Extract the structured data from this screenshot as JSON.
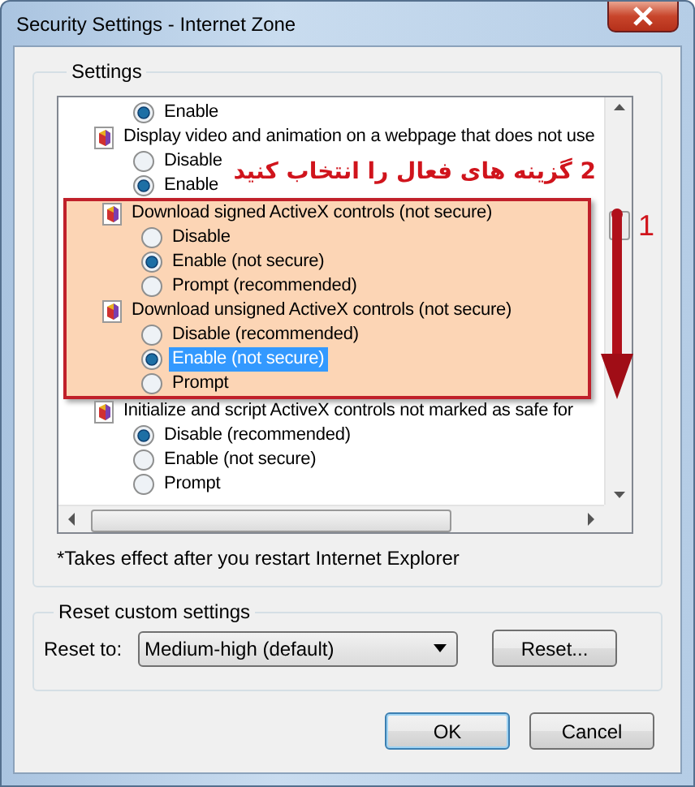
{
  "window": {
    "title": "Security Settings - Internet Zone"
  },
  "settings": {
    "label": "Settings",
    "items": [
      {
        "kind": "radio",
        "label": "Enable",
        "selected": true,
        "highlighted": false
      },
      {
        "kind": "heading",
        "label": "Display video and animation on a webpage that does not use"
      },
      {
        "kind": "radio",
        "label": "Disable",
        "selected": false,
        "highlighted": false
      },
      {
        "kind": "radio",
        "label": "Enable",
        "selected": true,
        "highlighted": false
      },
      {
        "kind": "annotated_group",
        "items": [
          {
            "kind": "heading",
            "label": "Download signed ActiveX controls (not secure)"
          },
          {
            "kind": "radio",
            "label": "Disable",
            "selected": false,
            "highlighted": false
          },
          {
            "kind": "radio",
            "label": "Enable (not secure)",
            "selected": true,
            "highlighted": false
          },
          {
            "kind": "radio",
            "label": "Prompt (recommended)",
            "selected": false,
            "highlighted": false
          },
          {
            "kind": "heading",
            "label": "Download unsigned ActiveX controls (not secure)"
          },
          {
            "kind": "radio",
            "label": "Disable (recommended)",
            "selected": false,
            "highlighted": false
          },
          {
            "kind": "radio",
            "label": "Enable (not secure)",
            "selected": true,
            "highlighted": true
          },
          {
            "kind": "radio",
            "label": "Prompt",
            "selected": false,
            "highlighted": false
          }
        ]
      },
      {
        "kind": "heading",
        "label": "Initialize and script ActiveX controls not marked as safe for"
      },
      {
        "kind": "radio",
        "label": "Disable (recommended)",
        "selected": true,
        "highlighted": false
      },
      {
        "kind": "radio",
        "label": "Enable (not secure)",
        "selected": false,
        "highlighted": false
      },
      {
        "kind": "radio",
        "label": "Prompt",
        "selected": false,
        "highlighted": false
      }
    ],
    "note": "*Takes effect after you restart Internet Explorer"
  },
  "annotation": {
    "instruction": "2 گزینه های فعال را انتخاب کنید",
    "step": "1"
  },
  "reset": {
    "label": "Reset custom settings",
    "reset_to_label": "Reset to:",
    "level": "Medium-high (default)",
    "reset_button": "Reset..."
  },
  "buttons": [
    {
      "label": "OK",
      "default": true
    },
    {
      "label": "Cancel",
      "default": false
    }
  ]
}
